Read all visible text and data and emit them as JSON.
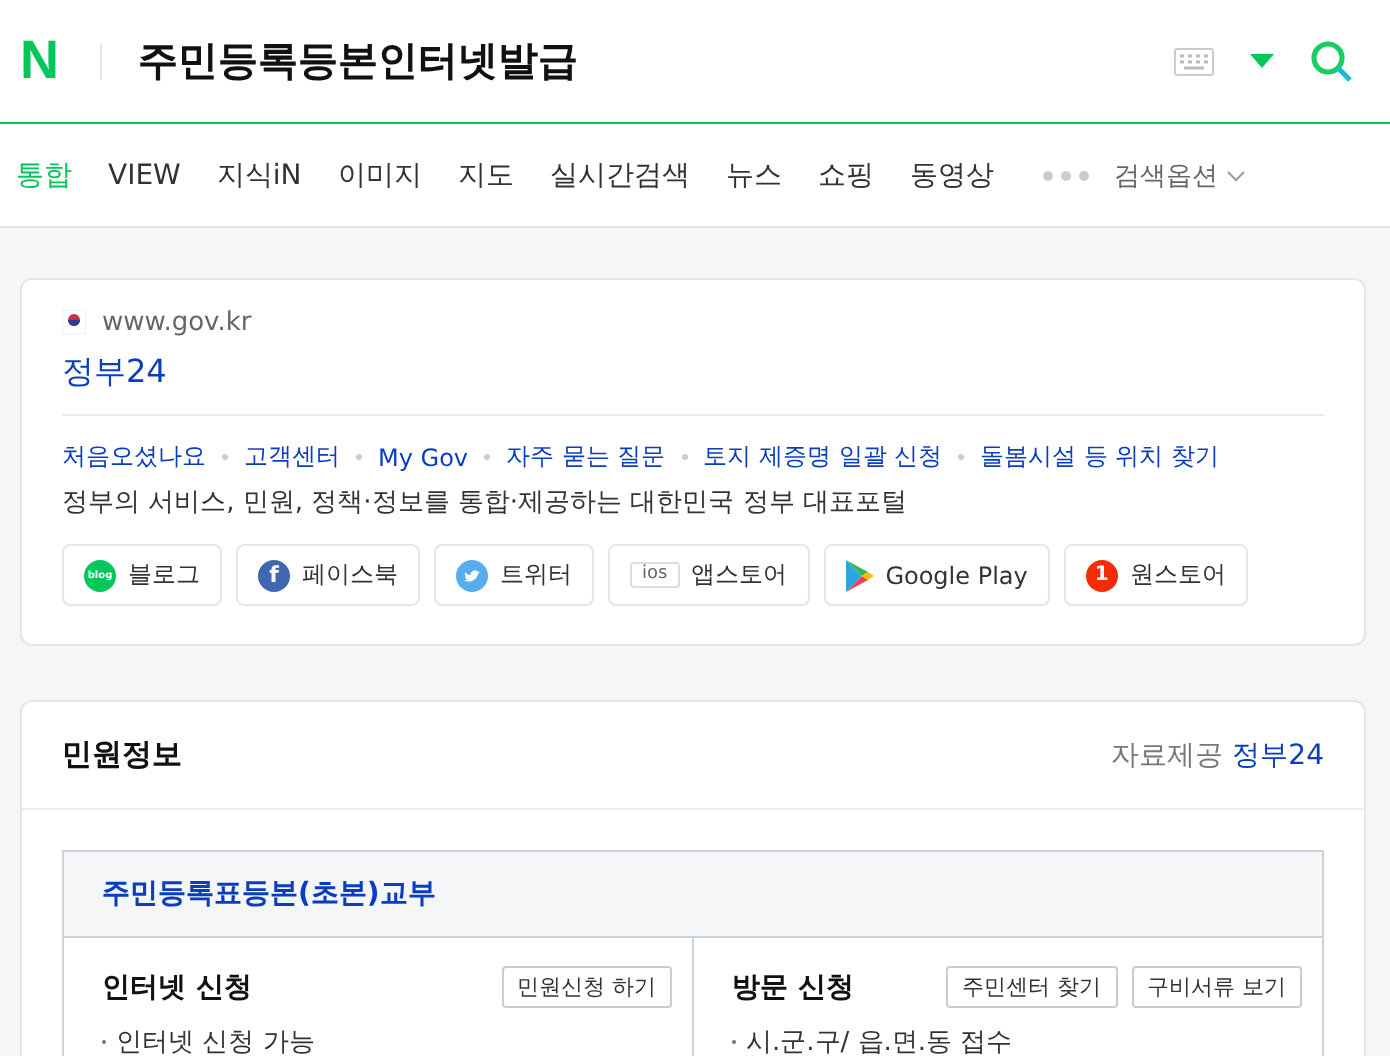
{
  "header": {
    "logo": "N",
    "query": "주민등록등본인터넷발급"
  },
  "tabs": [
    {
      "label": "통합",
      "selected": true
    },
    {
      "label": "VIEW",
      "selected": false
    },
    {
      "label": "지식iN",
      "selected": false
    },
    {
      "label": "이미지",
      "selected": false
    },
    {
      "label": "지도",
      "selected": false
    },
    {
      "label": "실시간검색",
      "selected": false
    },
    {
      "label": "뉴스",
      "selected": false
    },
    {
      "label": "쇼핑",
      "selected": false
    },
    {
      "label": "동영상",
      "selected": false
    }
  ],
  "search_options": "검색옵션",
  "site": {
    "url": "www.gov.kr",
    "title": "정부24",
    "links": [
      "처음오셨나요",
      "고객센터",
      "My Gov",
      "자주 묻는 질문",
      "토지 제증명 일괄 신청",
      "돌봄시설 등 위치 찾기"
    ],
    "description": "정부의 서비스, 민원, 정책·정보를 통합·제공하는 대한민국 정부 대표포털",
    "channels": [
      {
        "kind": "blog",
        "label": "블로그",
        "icon_text": "blog"
      },
      {
        "kind": "facebook",
        "label": "페이스북",
        "icon_text": "f"
      },
      {
        "kind": "twitter",
        "label": "트위터"
      },
      {
        "kind": "ios",
        "label": "앱스토어",
        "icon_text": "ios"
      },
      {
        "kind": "googleplay",
        "label": "Google Play"
      },
      {
        "kind": "onestore",
        "label": "원스토어",
        "icon_text": "1"
      }
    ]
  },
  "civil": {
    "title": "민원정보",
    "source_label": "자료제공",
    "source": "정부24",
    "service": "주민등록표등본(초본)교부",
    "columns": [
      {
        "title": "인터넷 신청",
        "buttons": [
          "민원신청 하기"
        ],
        "items": [
          "인터넷 신청 가능"
        ]
      },
      {
        "title": "방문 신청",
        "buttons": [
          "주민센터 찾기",
          "구비서류 보기"
        ],
        "items": [
          "시.군.구/ 읍.면.동 접수"
        ]
      }
    ]
  }
}
